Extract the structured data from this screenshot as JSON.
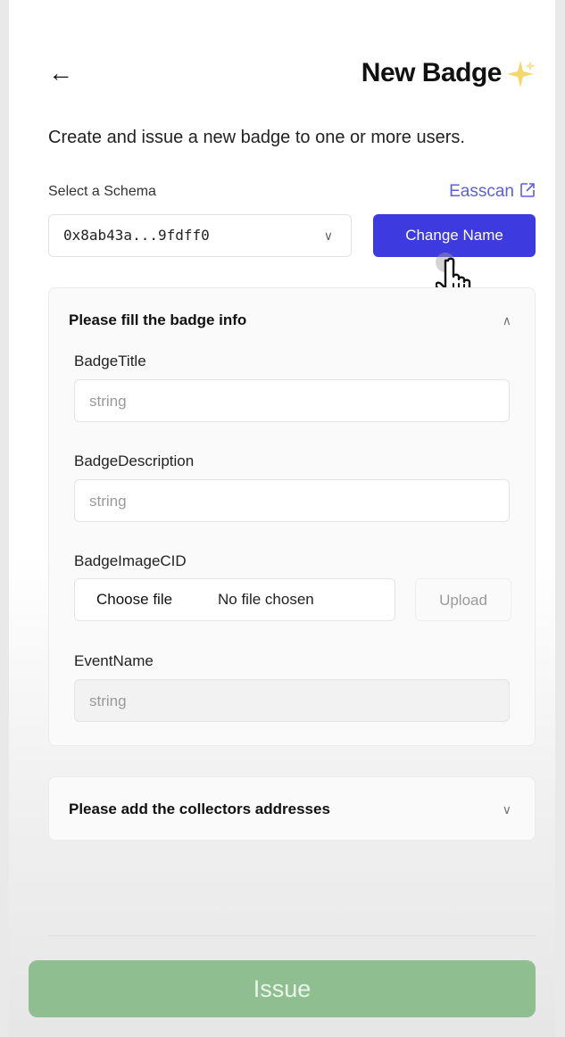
{
  "header": {
    "back_icon": "arrow-left-icon",
    "title": "New Badge",
    "sparkle_icon": "sparkles-icon"
  },
  "subtitle": "Create and issue a new badge to one or more users.",
  "schema": {
    "label": "Select a Schema",
    "selected_value": "0x8ab43a...9fdff0",
    "easscan_link": "Easscan",
    "easscan_icon": "external-link-icon",
    "change_button": "Change Name"
  },
  "badge_info": {
    "section_title": "Please fill the badge info",
    "fields": [
      {
        "label": "BadgeTitle",
        "placeholder": "string"
      },
      {
        "label": "BadgeDescription",
        "placeholder": "string"
      },
      {
        "label": "BadgeImageCID",
        "choose_file": "Choose file",
        "file_status": "No file chosen",
        "upload": "Upload"
      },
      {
        "label": "EventName",
        "placeholder": "string"
      }
    ]
  },
  "collectors": {
    "section_title": "Please add the collectors addresses"
  },
  "issue_button": "Issue",
  "colors": {
    "primary": "#3d3ae0",
    "link": "#5a5fe0",
    "issue_disabled": "#8fbf90"
  }
}
